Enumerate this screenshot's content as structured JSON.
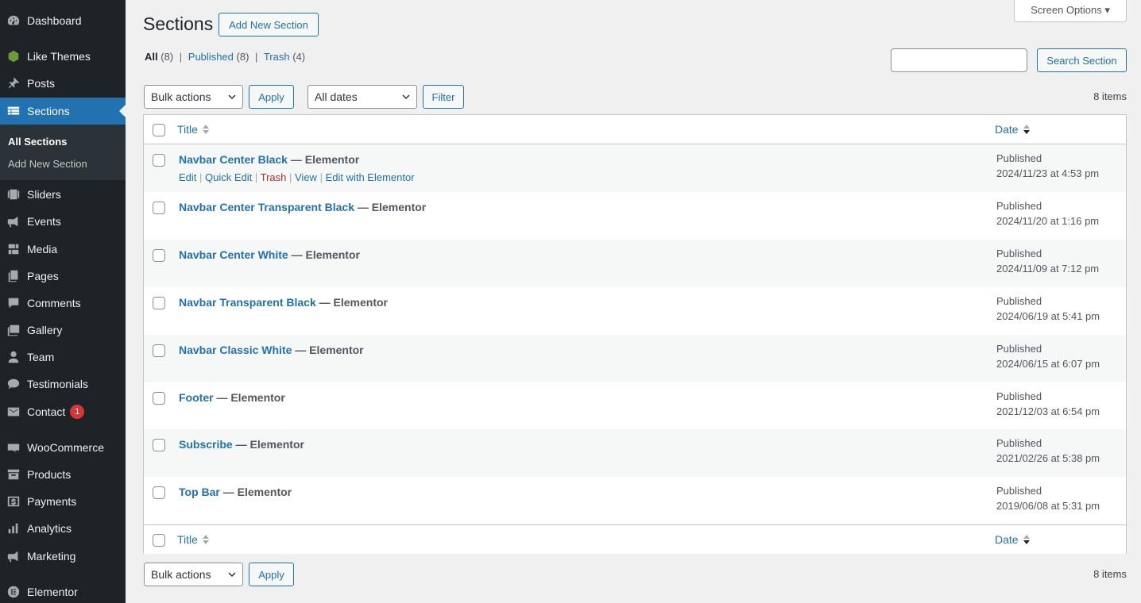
{
  "sidebar": {
    "items": [
      {
        "label": "Dashboard",
        "icon": "dashboard-icon"
      },
      {
        "label": "Like Themes",
        "icon": "leaf-icon"
      },
      {
        "label": "Posts",
        "icon": "pushpin-icon"
      },
      {
        "label": "Sections",
        "icon": "table-icon"
      },
      {
        "label": "Sliders",
        "icon": "slides-icon"
      },
      {
        "label": "Events",
        "icon": "megaphone-icon"
      },
      {
        "label": "Media",
        "icon": "media-icon"
      },
      {
        "label": "Pages",
        "icon": "pages-icon"
      },
      {
        "label": "Comments",
        "icon": "comment-icon"
      },
      {
        "label": "Gallery",
        "icon": "gallery-icon"
      },
      {
        "label": "Team",
        "icon": "person-icon"
      },
      {
        "label": "Testimonials",
        "icon": "testimonial-icon"
      },
      {
        "label": "Contact",
        "icon": "email-icon",
        "badge": "1"
      },
      {
        "label": "WooCommerce",
        "icon": "woo-icon"
      },
      {
        "label": "Products",
        "icon": "archive-icon"
      },
      {
        "label": "Payments",
        "icon": "dollar-icon"
      },
      {
        "label": "Analytics",
        "icon": "bar-chart-icon"
      },
      {
        "label": "Marketing",
        "icon": "megaphone-icon"
      },
      {
        "label": "Elementor",
        "icon": "elementor-icon"
      }
    ],
    "submenu": {
      "all": "All Sections",
      "add": "Add New Section"
    }
  },
  "header": {
    "title": "Sections",
    "add_new": "Add New Section",
    "screen_options": "Screen Options ▾"
  },
  "views": {
    "all": "All",
    "all_count": "(8)",
    "published": "Published",
    "published_count": "(8)",
    "trash": "Trash",
    "trash_count": "(4)",
    "sep": "|"
  },
  "search": {
    "value": "",
    "button": "Search Section"
  },
  "toolbar": {
    "bulk": "Bulk actions",
    "apply": "Apply",
    "dates": "All dates",
    "filter": "Filter",
    "count": "8 items"
  },
  "table": {
    "col_title": "Title",
    "col_date": "Date",
    "separator": " — ",
    "row_actions": {
      "edit": "Edit",
      "quick_edit": "Quick Edit",
      "trash": "Trash",
      "view": "View",
      "elementor": "Edit with Elementor"
    },
    "rows": [
      {
        "title": "Navbar Center Black",
        "state": "Elementor",
        "status": "Published",
        "date": "2024/11/23 at 4:53 pm"
      },
      {
        "title": "Navbar Center Transparent Black",
        "state": "Elementor",
        "status": "Published",
        "date": "2024/11/20 at 1:16 pm"
      },
      {
        "title": "Navbar Center White",
        "state": "Elementor",
        "status": "Published",
        "date": "2024/11/09 at 7:12 pm"
      },
      {
        "title": "Navbar Transparent Black",
        "state": "Elementor",
        "status": "Published",
        "date": "2024/06/19 at 5:41 pm"
      },
      {
        "title": "Navbar Classic White",
        "state": "Elementor",
        "status": "Published",
        "date": "2024/06/15 at 6:07 pm"
      },
      {
        "title": "Footer",
        "state": "Elementor",
        "status": "Published",
        "date": "2021/12/03 at 6:54 pm"
      },
      {
        "title": "Subscribe",
        "state": "Elementor",
        "status": "Published",
        "date": "2021/02/26 at 5:38 pm"
      },
      {
        "title": "Top Bar",
        "state": "Elementor",
        "status": "Published",
        "date": "2019/06/08 at 5:31 pm"
      }
    ]
  },
  "colors": {
    "sidebar": "#1d2327",
    "active": "#2271b1",
    "link": "#2271b1",
    "trash": "#b32d2e",
    "badge": "#d63638"
  }
}
